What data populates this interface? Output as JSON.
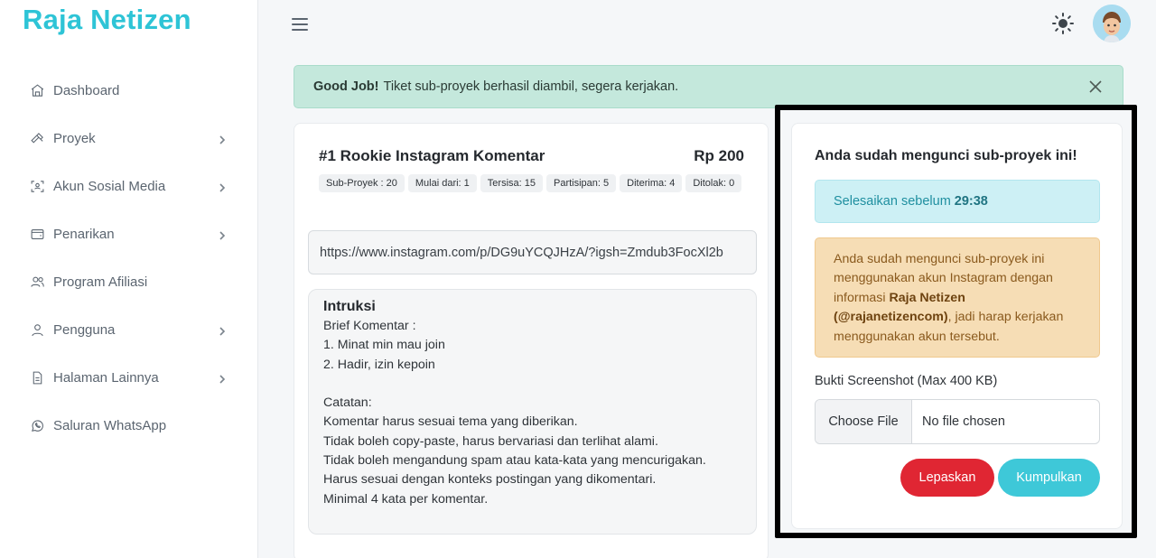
{
  "brand": "Raja Netizen",
  "sidebar": {
    "items": [
      {
        "label": "Dashboard",
        "icon": "home-icon",
        "chevron": false
      },
      {
        "label": "Proyek",
        "icon": "hammer-icon",
        "chevron": true
      },
      {
        "label": "Akun Sosial Media",
        "icon": "scan-user-icon",
        "chevron": true
      },
      {
        "label": "Penarikan",
        "icon": "wallet-icon",
        "chevron": true
      },
      {
        "label": "Program Afiliasi",
        "icon": "users-icon",
        "chevron": false
      },
      {
        "label": "Pengguna",
        "icon": "user-icon",
        "chevron": true
      },
      {
        "label": "Halaman Lainnya",
        "icon": "file-text-icon",
        "chevron": true
      },
      {
        "label": "Saluran WhatsApp",
        "icon": "whatsapp-icon",
        "chevron": false
      }
    ]
  },
  "alert": {
    "bold": "Good Job!",
    "text": "Tiket sub-proyek berhasil diambil, segera kerjakan."
  },
  "task": {
    "title": "#1 Rookie Instagram Komentar",
    "price": "Rp 200",
    "badges": [
      "Sub-Proyek : 20",
      "Mulai dari: 1",
      "Tersisa: 15",
      "Partisipan: 5",
      "Diterima: 4",
      "Ditolak: 0"
    ],
    "url": "https://www.instagram.com/p/DG9uYCQJHzA/?igsh=Zmdub3FocXl2b",
    "instruction_title": "Intruksi",
    "instruction_body": "Brief Komentar :\n1. Minat min mau join\n2. Hadir, izin kepoin\n\nCatatan:\nKomentar harus sesuai tema yang diberikan.\nTidak boleh copy-paste, harus bervariasi dan terlihat alami.\nTidak boleh mengandung spam atau kata-kata yang mencurigakan.\nHarus sesuai dengan konteks postingan yang dikomentari.\nMinimal 4 kata per komentar."
  },
  "lock": {
    "title": "Anda sudah mengunci sub-proyek ini!",
    "timer_label": "Selesaikan sebelum",
    "timer_value": "29:38",
    "warn_prefix": "Anda sudah mengunci sub-proyek ini menggunakan akun Instagram dengan informasi",
    "warn_account": "Raja Netizen (@rajanetizencom)",
    "warn_suffix": ", jadi harap kerjakan menggunakan akun tersebut.",
    "file_label": "Bukti Screenshot (Max 400 KB)",
    "file_button": "Choose File",
    "file_status": "No file chosen",
    "release_label": "Lepaskan",
    "submit_label": "Kumpulkan"
  },
  "colors": {
    "brand": "#2ec4d6",
    "alert_bg": "#c4e8dc",
    "danger": "#e02633",
    "info": "#3ec8d8",
    "warning_bg": "#f6ddb5"
  }
}
